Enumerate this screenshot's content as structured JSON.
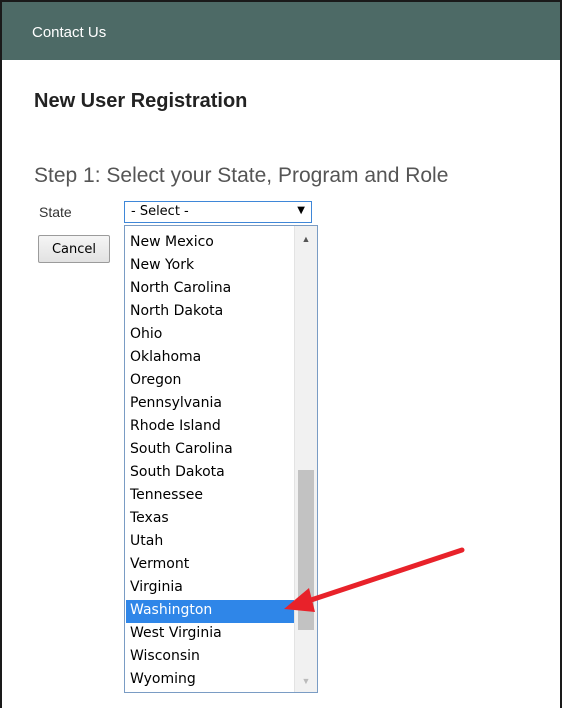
{
  "header": {
    "contact_link": "Contact Us"
  },
  "page": {
    "title": "New User Registration",
    "step_heading": "Step 1: Select your State, Program and Role"
  },
  "form": {
    "state_label": "State",
    "state_select_value": "- Select -",
    "cancel_label": "Cancel"
  },
  "dropdown": {
    "options": [
      "New Mexico",
      "New York",
      "North Carolina",
      "North Dakota",
      "Ohio",
      "Oklahoma",
      "Oregon",
      "Pennsylvania",
      "Rhode Island",
      "South Carolina",
      "South Dakota",
      "Tennessee",
      "Texas",
      "Utah",
      "Vermont",
      "Virginia",
      "Washington",
      "West Virginia",
      "Wisconsin",
      "Wyoming"
    ],
    "highlighted": "Washington",
    "scroll_position": 0.85
  },
  "colors": {
    "header_bg": "#4d6a66",
    "highlight": "#2f86e8",
    "annotation_arrow": "#e8222a"
  },
  "icons": {
    "select_arrow": "chevron-down-icon",
    "scroll_up": "scroll-up-icon",
    "scroll_down": "scroll-down-icon",
    "annotation": "red-arrow-icon"
  }
}
